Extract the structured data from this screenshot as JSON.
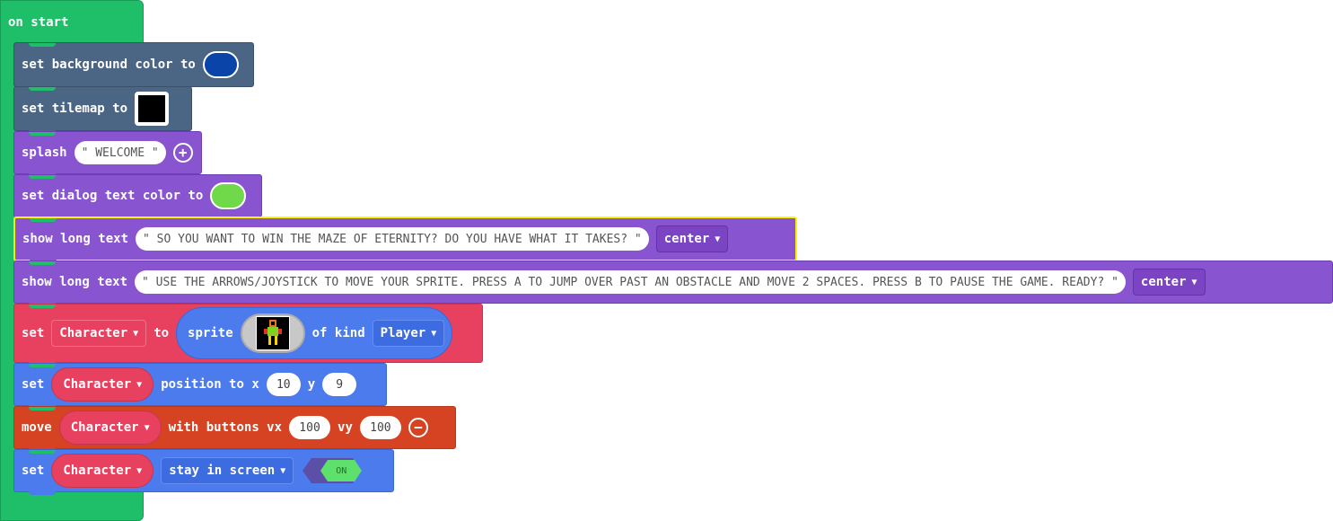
{
  "on_start": {
    "label": "on start"
  },
  "blocks": {
    "bg": {
      "label": "set background color to",
      "color": "#0a44a8"
    },
    "tilemap": {
      "label": "set tilemap to"
    },
    "splash": {
      "label": "splash",
      "text": "\" WELCOME \""
    },
    "dialog_color": {
      "label": "set dialog text color to",
      "color": "#6fd94a"
    },
    "long1": {
      "label": "show long text",
      "text": "\" SO YOU WANT TO WIN THE MAZE OF ETERNITY? DO YOU HAVE WHAT IT TAKES? \"",
      "align": "center"
    },
    "long2": {
      "label": "show long text",
      "text": "\" USE THE ARROWS/JOYSTICK TO MOVE YOUR SPRITE. PRESS A TO JUMP OVER PAST AN OBSTACLE AND MOVE 2 SPACES. PRESS B TO PAUSE THE GAME. READY? \"",
      "align": "center"
    },
    "set_sprite": {
      "set": "set",
      "var": "Character",
      "to": "to",
      "sprite": "sprite",
      "of_kind": "of kind",
      "kind": "Player"
    },
    "position": {
      "set": "set",
      "var": "Character",
      "label": "position to x",
      "x": "10",
      "y_label": "y",
      "y": "9"
    },
    "move": {
      "label": "move",
      "var": "Character",
      "with": "with buttons vx",
      "vx": "100",
      "vy_label": "vy",
      "vy": "100"
    },
    "stay": {
      "set": "set",
      "var": "Character",
      "flag": "stay in screen",
      "toggle": "ON"
    }
  },
  "icons": {
    "add": "plus-circle-icon",
    "remove": "minus-circle-icon",
    "dropdown": "caret-down-icon"
  }
}
